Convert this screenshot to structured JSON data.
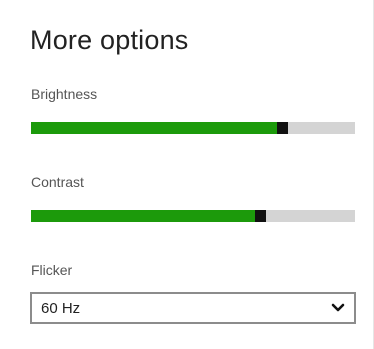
{
  "panel": {
    "title": "More options"
  },
  "brightness": {
    "label": "Brightness",
    "level_percent": 76
  },
  "contrast": {
    "label": "Contrast",
    "level_percent": 69
  },
  "flicker": {
    "label": "Flicker",
    "selected": "60 Hz",
    "icon": "chevron-down-icon"
  },
  "colors": {
    "fill": "#1c9a0b",
    "track": "#d4d4d4",
    "thumb": "#111111"
  }
}
